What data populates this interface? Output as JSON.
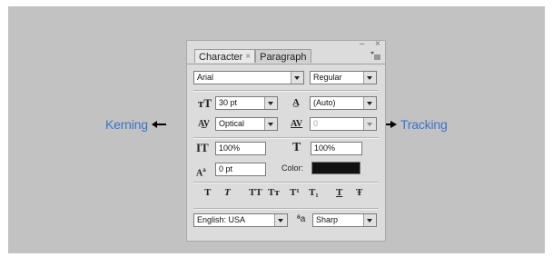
{
  "callouts": {
    "left": "Kerning",
    "right": "Tracking"
  },
  "panel": {
    "window_buttons": {
      "minimize": "– ",
      "close": "×"
    },
    "tabs": [
      {
        "label": "Character",
        "close": "×"
      },
      {
        "label": "Paragraph"
      }
    ],
    "font_family": "Arial",
    "font_style": "Regular",
    "font_size": "30 pt",
    "leading": "(Auto)",
    "kerning": "Optical",
    "tracking": "0",
    "vertical_scale": "100%",
    "horizontal_scale": "100%",
    "baseline_shift": "0 pt",
    "color_label": "Color:",
    "text_color": "#111111",
    "format_buttons": [
      "T",
      "T",
      "TT",
      "Tт",
      "T¹",
      "T₁",
      "T",
      "Ŧ"
    ],
    "language": "English: USA",
    "antialias_label": "ªa",
    "antialias": "Sharp"
  },
  "accent_color": "#3a73c9"
}
